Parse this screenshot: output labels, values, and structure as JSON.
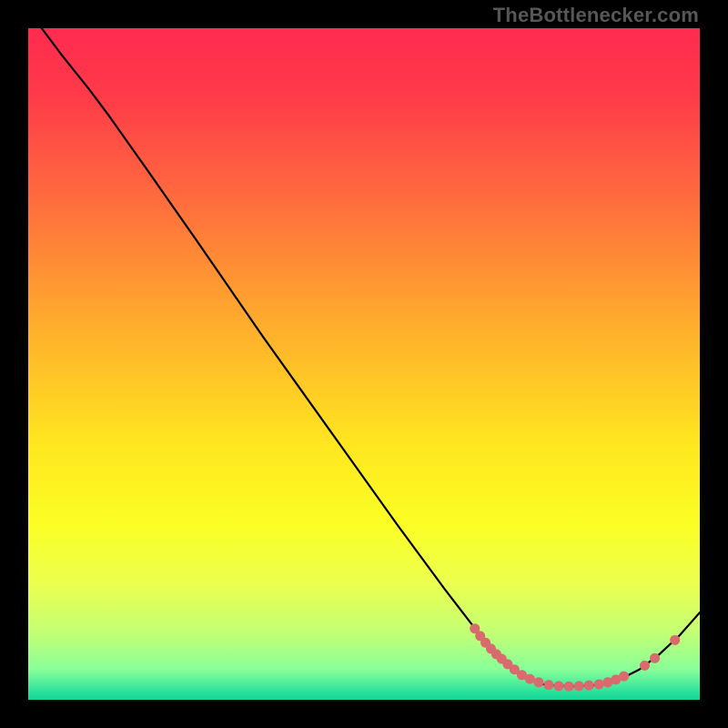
{
  "watermark": "TheBottleneсker.com",
  "chart_data": {
    "type": "line",
    "title": "",
    "xlabel": "",
    "ylabel": "",
    "xlim": [
      0,
      100
    ],
    "ylim": [
      0,
      100
    ],
    "gradient_stops": [
      {
        "offset": 0.0,
        "color": "#ff2b4f"
      },
      {
        "offset": 0.1,
        "color": "#ff3a49"
      },
      {
        "offset": 0.25,
        "color": "#ff6a3e"
      },
      {
        "offset": 0.45,
        "color": "#ffb02c"
      },
      {
        "offset": 0.62,
        "color": "#ffe61f"
      },
      {
        "offset": 0.74,
        "color": "#fbff25"
      },
      {
        "offset": 0.83,
        "color": "#eaff50"
      },
      {
        "offset": 0.9,
        "color": "#c3ff74"
      },
      {
        "offset": 0.955,
        "color": "#88ff99"
      },
      {
        "offset": 0.985,
        "color": "#33e59b"
      },
      {
        "offset": 1.0,
        "color": "#11d498"
      }
    ],
    "curve": [
      {
        "x": 2.0,
        "y": 100.0
      },
      {
        "x": 5.0,
        "y": 96.0
      },
      {
        "x": 9.0,
        "y": 91.0
      },
      {
        "x": 12.0,
        "y": 87.0
      },
      {
        "x": 18.0,
        "y": 78.5
      },
      {
        "x": 25.0,
        "y": 68.5
      },
      {
        "x": 35.0,
        "y": 54.0
      },
      {
        "x": 45.0,
        "y": 40.0
      },
      {
        "x": 55.0,
        "y": 26.0
      },
      {
        "x": 62.0,
        "y": 16.5
      },
      {
        "x": 67.0,
        "y": 10.0
      },
      {
        "x": 71.0,
        "y": 5.5
      },
      {
        "x": 74.0,
        "y": 3.2
      },
      {
        "x": 77.0,
        "y": 2.2
      },
      {
        "x": 81.0,
        "y": 2.0
      },
      {
        "x": 85.0,
        "y": 2.2
      },
      {
        "x": 88.0,
        "y": 3.0
      },
      {
        "x": 91.0,
        "y": 4.5
      },
      {
        "x": 94.0,
        "y": 6.8
      },
      {
        "x": 97.0,
        "y": 9.6
      },
      {
        "x": 100.0,
        "y": 13.0
      }
    ],
    "markers": [
      {
        "x": 66.5,
        "y": 10.6
      },
      {
        "x": 67.3,
        "y": 9.5
      },
      {
        "x": 68.1,
        "y": 8.5
      },
      {
        "x": 68.9,
        "y": 7.6
      },
      {
        "x": 69.7,
        "y": 6.8
      },
      {
        "x": 70.5,
        "y": 6.1
      },
      {
        "x": 71.4,
        "y": 5.3
      },
      {
        "x": 72.4,
        "y": 4.5
      },
      {
        "x": 73.5,
        "y": 3.7
      },
      {
        "x": 74.7,
        "y": 3.1
      },
      {
        "x": 76.0,
        "y": 2.6
      },
      {
        "x": 77.5,
        "y": 2.2
      },
      {
        "x": 79.0,
        "y": 2.05
      },
      {
        "x": 80.5,
        "y": 2.0
      },
      {
        "x": 82.0,
        "y": 2.05
      },
      {
        "x": 83.5,
        "y": 2.15
      },
      {
        "x": 85.0,
        "y": 2.3
      },
      {
        "x": 86.3,
        "y": 2.6
      },
      {
        "x": 87.5,
        "y": 3.0
      },
      {
        "x": 88.7,
        "y": 3.5
      },
      {
        "x": 91.8,
        "y": 5.1
      },
      {
        "x": 93.3,
        "y": 6.2
      },
      {
        "x": 96.3,
        "y": 8.9
      }
    ]
  }
}
